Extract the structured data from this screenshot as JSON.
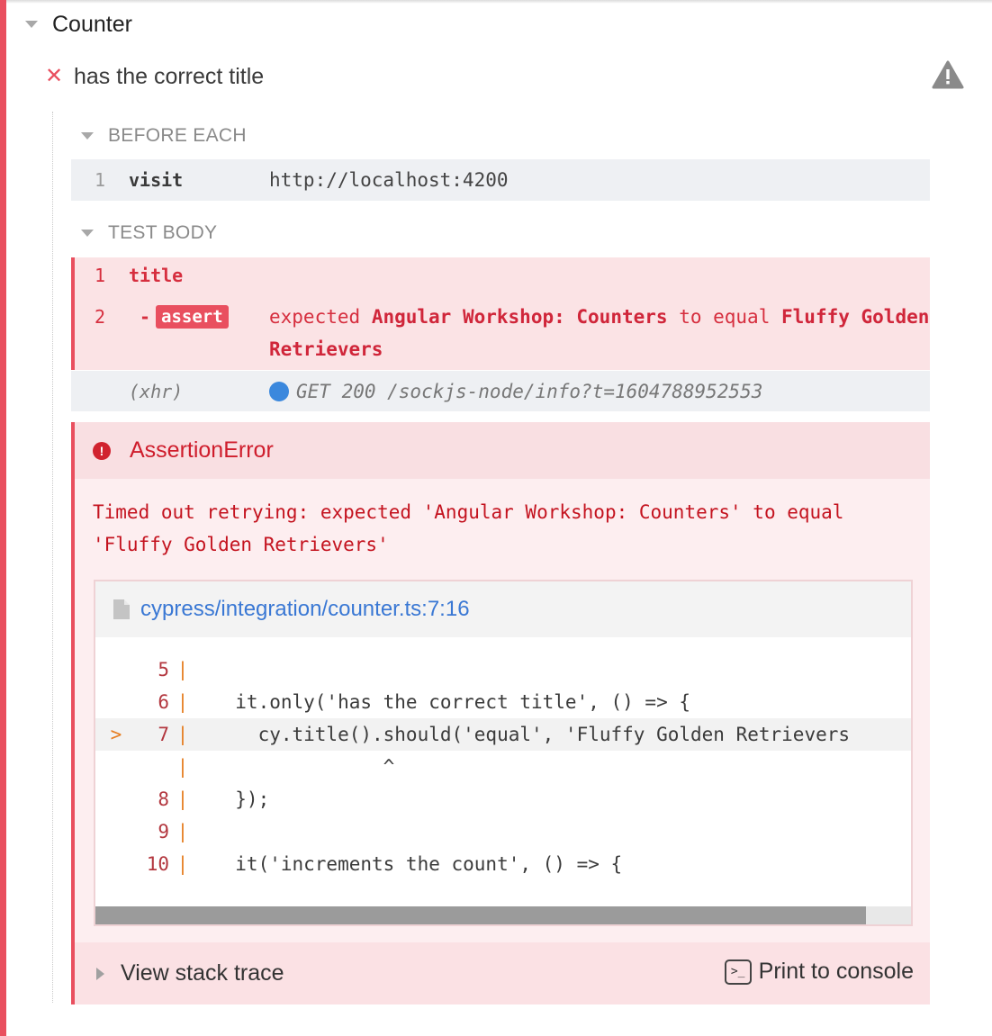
{
  "suite": {
    "title": "Counter"
  },
  "test": {
    "title": "has the correct title"
  },
  "hooks": [
    {
      "label": "BEFORE EACH"
    },
    {
      "label": "TEST BODY"
    }
  ],
  "before_each": [
    {
      "num": "1",
      "name": "visit",
      "message": "http://localhost:4200"
    }
  ],
  "test_body": {
    "title_row": {
      "num": "1",
      "name": "title"
    },
    "assert_row": {
      "num": "2",
      "dash": "-",
      "name": "assert",
      "msg_expected": "expected",
      "msg_actual": "Angular Workshop: Counters",
      "msg_to_equal": "to equal",
      "msg_target": "Fluffy Golden Retrievers"
    },
    "xhr_row": {
      "name": "(xhr)",
      "message": "GET 200 /sockjs-node/info?t=1604788952553"
    }
  },
  "error": {
    "title": "AssertionError",
    "icon": "!",
    "message": "Timed out retrying: expected 'Angular Workshop: Counters' to equal 'Fluffy Golden Retrievers'",
    "file": "cypress/integration/counter.ts:7:16",
    "code_lines": [
      {
        "marker": "",
        "num": "5",
        "bar": "|",
        "code": ""
      },
      {
        "marker": "",
        "num": "6",
        "bar": "|",
        "code": "  it.only('has the correct title', () => {"
      },
      {
        "marker": ">",
        "num": "7",
        "bar": "|",
        "code": "    cy.title().should('equal', 'Fluffy Golden Retrievers"
      },
      {
        "marker": "",
        "num": "",
        "bar": "|",
        "code": "               ^"
      },
      {
        "marker": "",
        "num": "8",
        "bar": "|",
        "code": "  });"
      },
      {
        "marker": "",
        "num": "9",
        "bar": "|",
        "code": ""
      },
      {
        "marker": "",
        "num": "10",
        "bar": "|",
        "code": "  it('increments the count', () => {"
      }
    ],
    "view_stack_trace": "View stack trace",
    "print_to_console": "Print to console",
    "print_icon_text": ">_"
  },
  "colors": {
    "fail": "#e94f5f",
    "error_text": "#c4131f",
    "link": "#3a78d4",
    "xhr_dot": "#3b88dd"
  }
}
